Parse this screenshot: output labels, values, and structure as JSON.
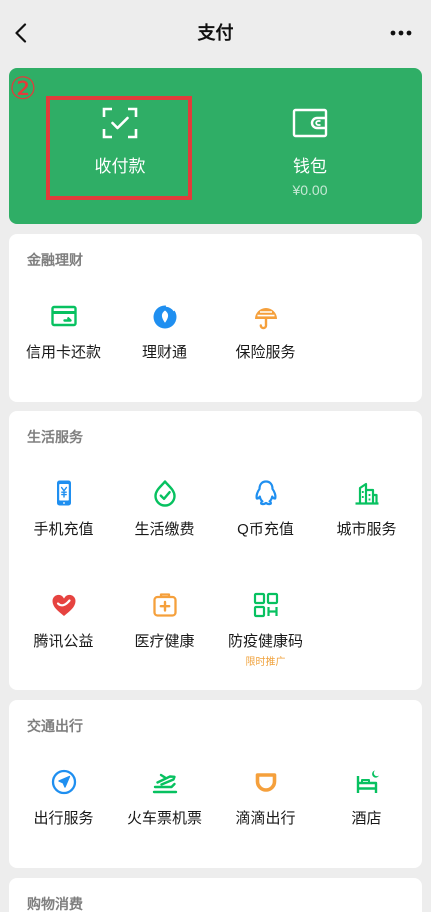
{
  "header": {
    "back_icon": "back-arrow-icon",
    "title": "支付",
    "more_icon": "more-icon"
  },
  "annotation": {
    "marker": "②",
    "color": "#e23b3b"
  },
  "pay_card": {
    "color": "#2fae66",
    "receive": {
      "label": "收付款",
      "icon": "scan-check-icon"
    },
    "wallet": {
      "label": "钱包",
      "balance": "¥0.00",
      "icon": "wallet-icon"
    }
  },
  "sections": [
    {
      "title": "金融理财",
      "items": [
        {
          "label": "信用卡还款",
          "icon": "credit-card-icon",
          "color": "#07c160"
        },
        {
          "label": "理财通",
          "icon": "licaitong-icon",
          "color": "#1f8ff0"
        },
        {
          "label": "保险服务",
          "icon": "insurance-icon",
          "color": "#f5a03c"
        }
      ]
    },
    {
      "title": "生活服务",
      "items": [
        {
          "label": "手机充值",
          "icon": "phone-recharge-icon",
          "color": "#1f8ff0"
        },
        {
          "label": "生活缴费",
          "icon": "utility-payment-icon",
          "color": "#07c160"
        },
        {
          "label": "Q币充值",
          "icon": "qq-coin-icon",
          "color": "#1f8ff0"
        },
        {
          "label": "城市服务",
          "icon": "city-service-icon",
          "color": "#07c160"
        },
        {
          "label": "腾讯公益",
          "icon": "charity-heart-icon",
          "color": "#e64340"
        },
        {
          "label": "医疗健康",
          "icon": "medical-kit-icon",
          "color": "#f5a03c"
        },
        {
          "label": "防疫健康码",
          "sublabel": "限时推广",
          "sublabel_color": "#f0a23c",
          "icon": "health-code-icon",
          "color": "#07c160"
        }
      ]
    },
    {
      "title": "交通出行",
      "items": [
        {
          "label": "出行服务",
          "icon": "navigation-icon",
          "color": "#1f8ff0"
        },
        {
          "label": "火车票机票",
          "icon": "train-plane-icon",
          "color": "#07c160"
        },
        {
          "label": "滴滴出行",
          "icon": "didi-icon",
          "color": "#f5a03c"
        },
        {
          "label": "酒店",
          "icon": "hotel-bed-icon",
          "color": "#07c160"
        }
      ]
    },
    {
      "title": "购物消费"
    }
  ]
}
